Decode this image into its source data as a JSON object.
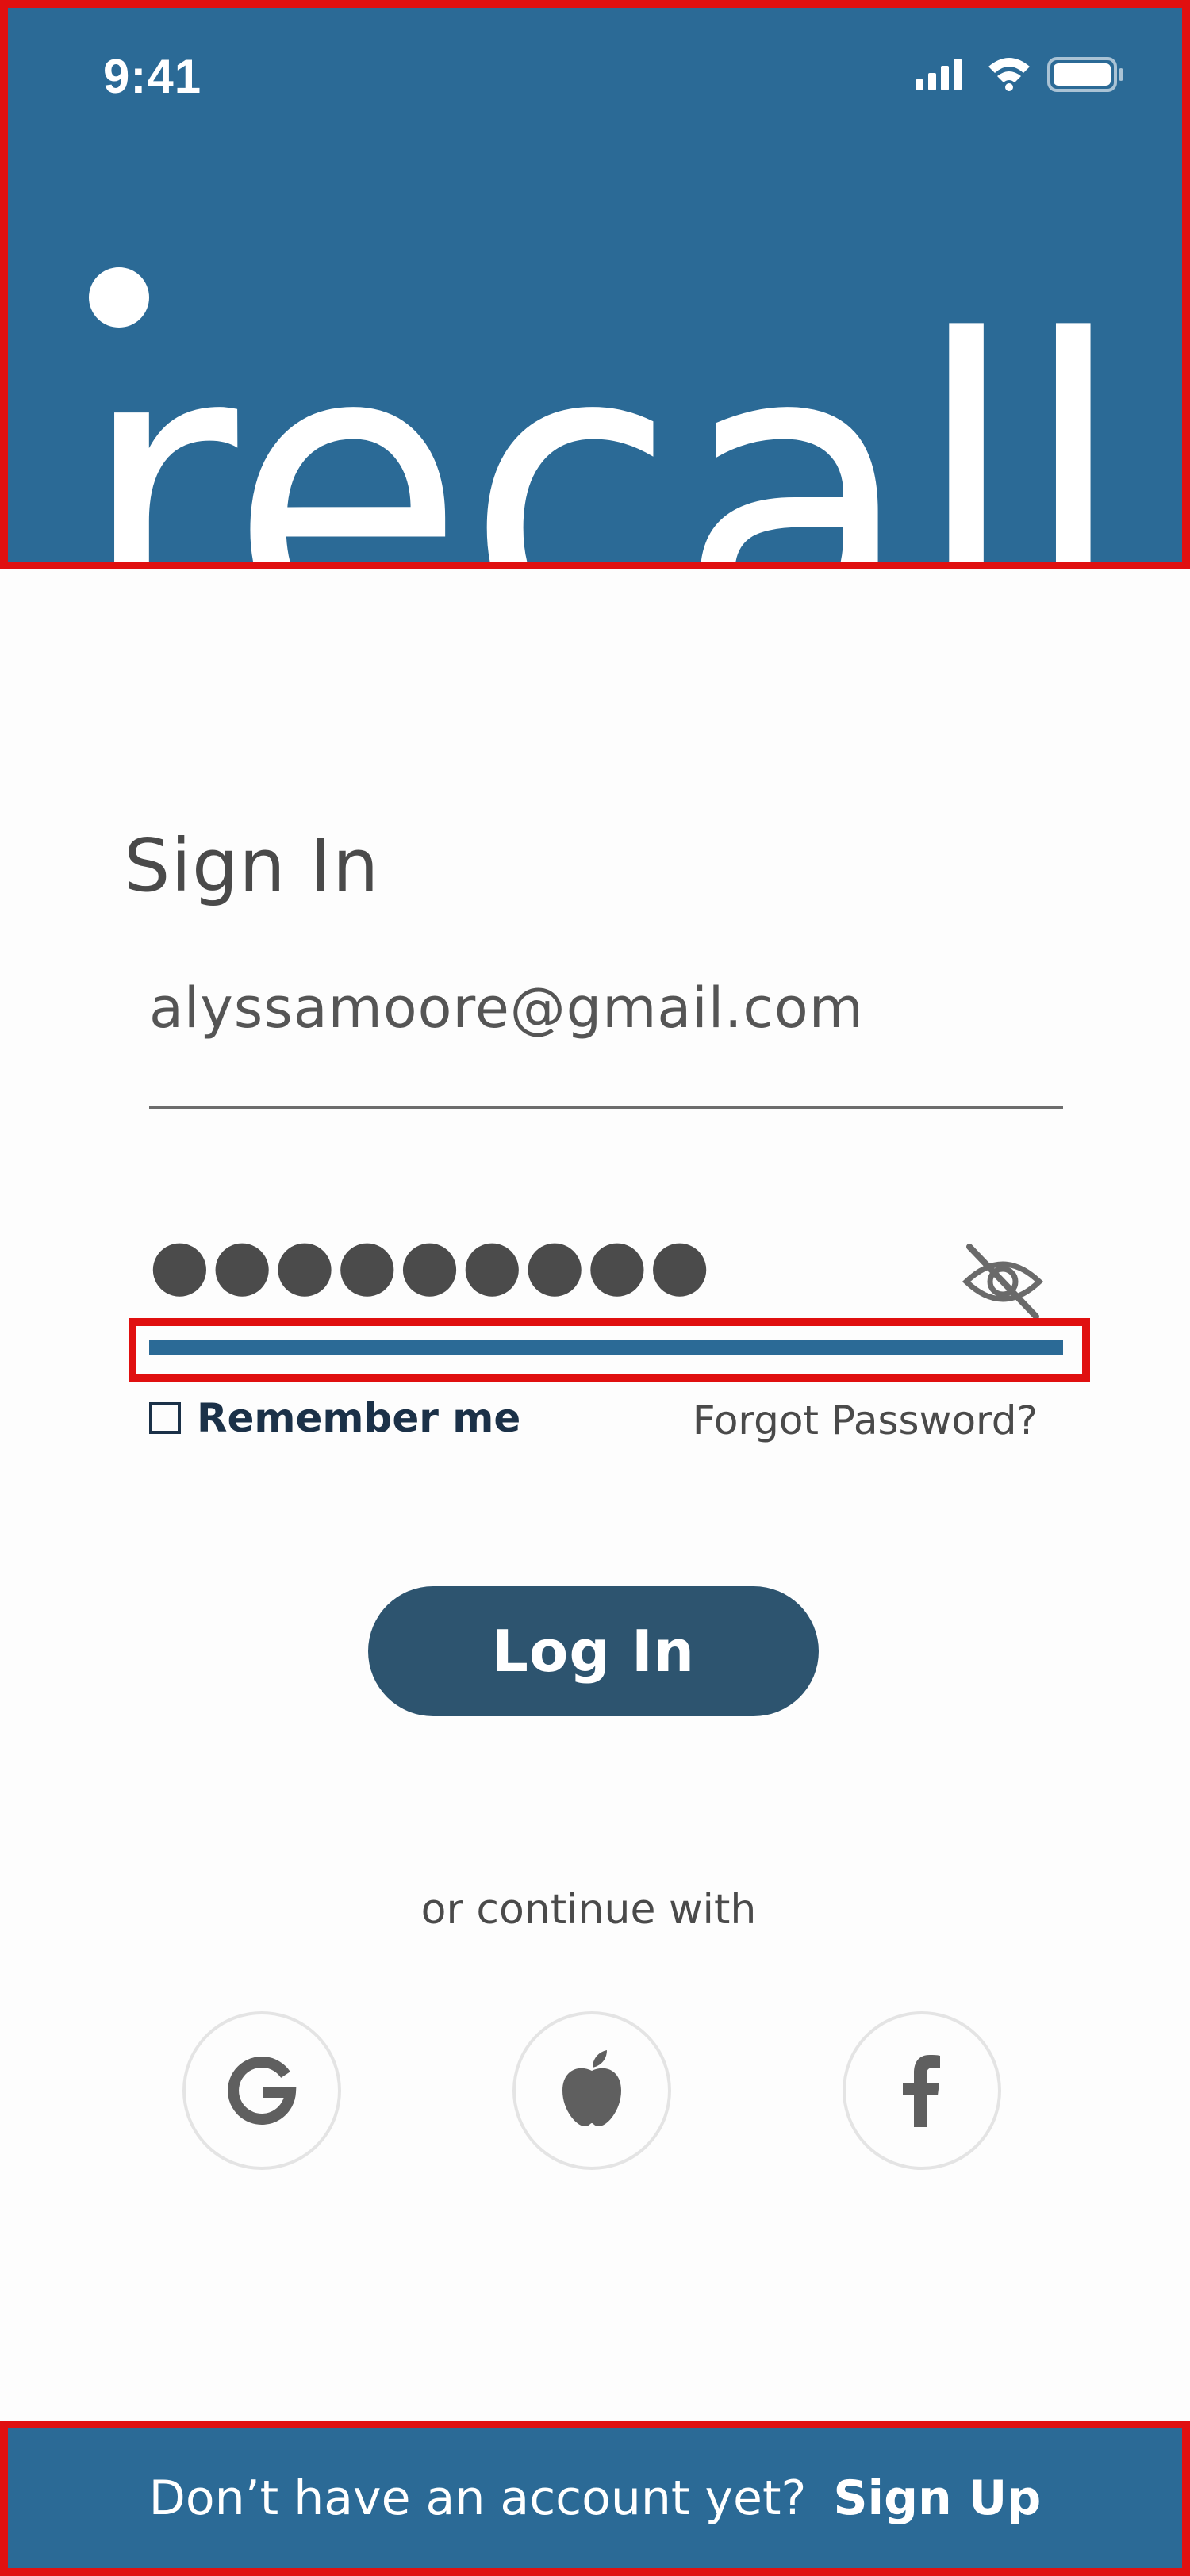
{
  "status_bar": {
    "time": "9:41"
  },
  "brand": {
    "logo_text": "recall",
    "color": "#2b6a96"
  },
  "signin": {
    "title": "Sign In",
    "email_value": "alyssamoore@gmail.com",
    "password_mask": "●●●●●●●●●",
    "remember_label": "Remember me",
    "forgot_label": "Forgot Password?",
    "login_label": "Log In",
    "continue_label": "or continue with"
  },
  "social": {
    "google_icon": "google-icon",
    "apple_icon": "apple-icon",
    "facebook_icon": "facebook-icon"
  },
  "footer": {
    "prompt": "Don’t have an account yet?",
    "signup_label": "Sign Up"
  },
  "colors": {
    "primary": "#2b6a96",
    "button": "#2d546f",
    "highlight": "#e01010"
  }
}
